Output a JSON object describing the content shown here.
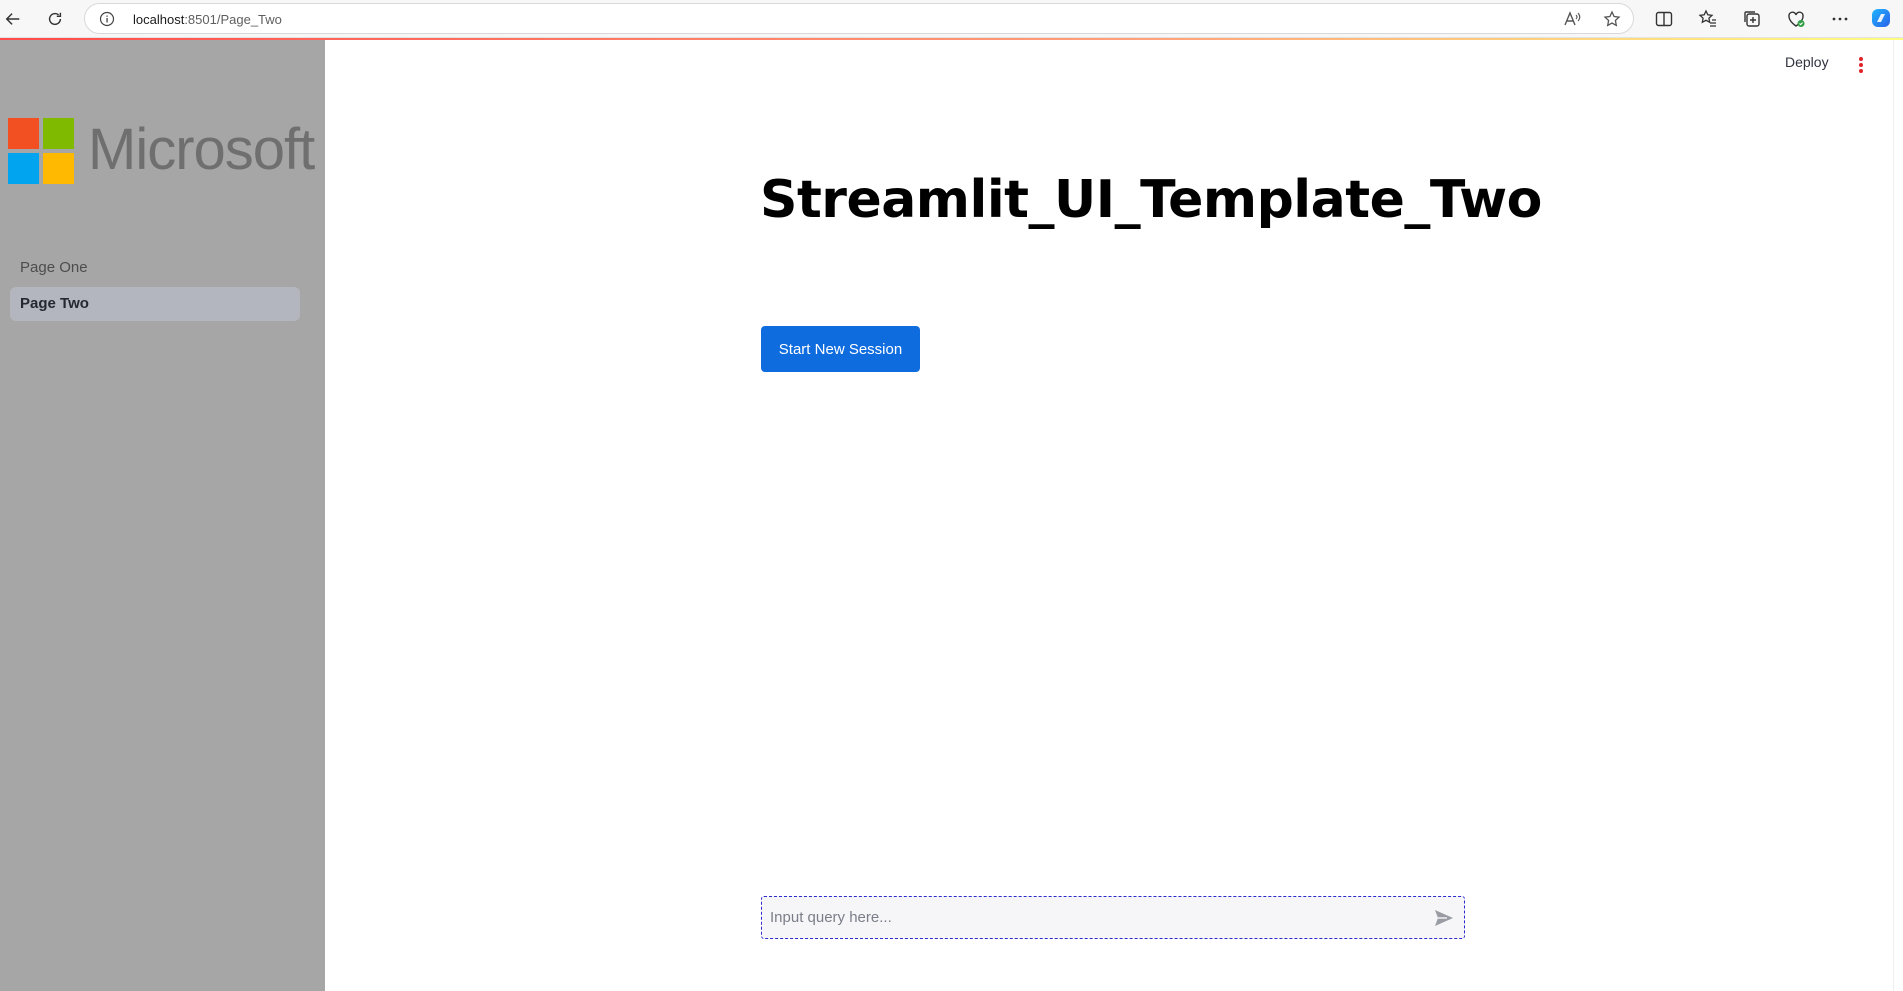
{
  "browser": {
    "url_host": "localhost",
    "url_path": ":8501/Page_Two",
    "icons": [
      "back-icon",
      "refresh-icon",
      "info-icon",
      "read-aloud-icon",
      "favorite-star-icon",
      "split-screen-icon",
      "favorites-icon",
      "collections-icon",
      "browser-essentials-icon",
      "more-icon",
      "copilot-icon"
    ]
  },
  "sidebar": {
    "logo_text": "Microsoft",
    "logo_colors": [
      "#f25022",
      "#7fba00",
      "#00a4ef",
      "#ffb900"
    ],
    "background": "#a6a6a6",
    "items": [
      {
        "label": "Page One",
        "active": false
      },
      {
        "label": "Page Two",
        "active": true
      }
    ]
  },
  "header": {
    "deploy_label": "Deploy",
    "menu_icon": "kebab-menu-icon",
    "accent": "#e0242c"
  },
  "main": {
    "title": "Streamlit_UI_Template_Two",
    "start_button_label": "Start New Session",
    "button_color": "#0f6cde"
  },
  "chat": {
    "placeholder": "Input query here...",
    "value": "",
    "send_icon": "send-icon"
  }
}
